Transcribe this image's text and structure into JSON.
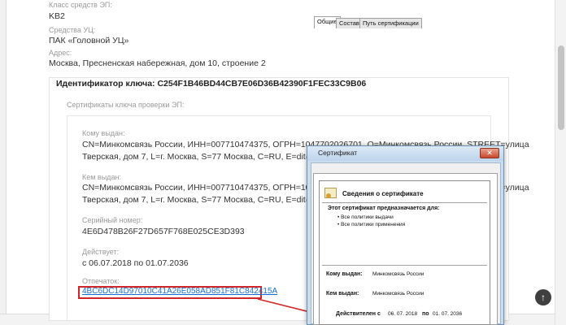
{
  "fields": {
    "class_label": "Класс средств ЭП:",
    "class_value": "KB2",
    "tools_label": "Средства УЦ:",
    "tools_value": "ПАК «Головной УЦ»",
    "address_label": "Адрес:",
    "address_value": "Москва, Пресненская набережная, дом 10, строение 2"
  },
  "key": {
    "title": "Идентификатор ключа: C254F1B46BD44CB7E06D36B42390F1FEC33C9B06",
    "certs_label": "Сертификаты ключа проверки ЭП:",
    "issued_to_label": "Кому выдан:",
    "issued_to_line1": "CN=Минкомсвязь России, ИНН=007710474375, ОГРН=1047702026701, O=Минкомсвязь России, STREET=улица",
    "issued_to_line2": "Тверская, дом 7, L=г. Москва, S=77 Москва, C=RU, E=dit@minsvyaz.ru",
    "issued_by_label": "Кем выдан:",
    "issued_by_line1": "CN=Минкомсвязь России, ИНН=007710474375, ОГРН=1047702026701, O=Минкомсвязь России, STREET=улица",
    "issued_by_line2": "Тверская, дом 7, L=г. Москва, S=77 Москва, C=RU, E=dit@minsvyaz.ru",
    "serial_label": "Серийный номер:",
    "serial_value": "4E6D478B26F27D657F768E025CE3D393",
    "valid_label": "Действует:",
    "valid_value": "с 06.07.2018 по 01.07.2036",
    "thumb_label": "Отпечаток:",
    "thumb_value": "4BC6DC14D97010C41A26E058AD851F81C842415A"
  },
  "dialog": {
    "title": "Сертификат",
    "close": "✕",
    "tabs": [
      "Общие",
      "Состав",
      "Путь сертификации"
    ],
    "info_title": "Сведения о сертификате",
    "purpose": "Этот сертификат предназначается для:",
    "bullets": [
      "Все политики выдачи",
      "Все политики применения"
    ],
    "issued_to_label": "Кому выдан:",
    "issued_to_value": "Минкомсвязь России",
    "issued_by_label": "Кем выдан:",
    "issued_by_value": "Минкомсвязь России",
    "valid_label": "Действителен с",
    "valid_from": "06. 07. 2018",
    "valid_to_label": "по",
    "valid_to": "01. 07. 2036"
  },
  "scroll_top": "↑",
  "colors": {
    "link": "#1a6fd2",
    "highlight": "#d0262a",
    "dialog_frame": "#c9ddf1"
  }
}
